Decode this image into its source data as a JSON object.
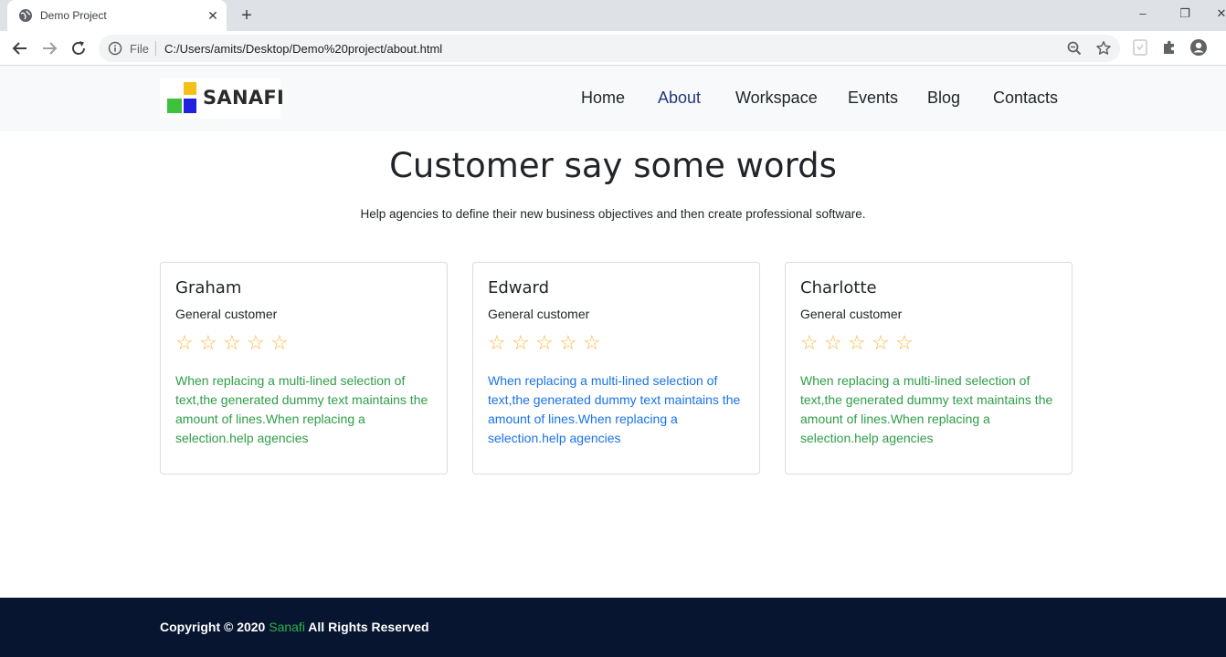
{
  "browser": {
    "tab_title": "Demo Project",
    "new_tab": "+",
    "close_tab": "✕",
    "window_controls": {
      "minimize": "–",
      "restore": "❐",
      "close": "✕"
    },
    "scheme_label": "File",
    "url": "C:/Users/amits/Desktop/Demo%20project/about.html"
  },
  "site": {
    "logo_text": "SANAFI",
    "nav": [
      {
        "label": "Home"
      },
      {
        "label": "About",
        "active": true
      },
      {
        "label": "Workspace"
      },
      {
        "label": "Events"
      },
      {
        "label": "Blog"
      },
      {
        "label": "Contacts"
      }
    ]
  },
  "hero": {
    "title": "Customer say some words",
    "subtitle": "Help agencies to define their new business objectives and then create professional software."
  },
  "testimonials": [
    {
      "name": "Graham",
      "role": "General customer",
      "rating": 0,
      "text": "When replacing a multi-lined selection of text,the generated dummy text maintains the amount of lines.When replacing a selection.help agencies",
      "text_color": "#2e9e47"
    },
    {
      "name": "Edward",
      "role": "General customer",
      "rating": 0,
      "text": "When replacing a multi-lined selection of text,the generated dummy text maintains the amount of lines.When replacing a selection.help agencies",
      "text_color": "#1a73e8"
    },
    {
      "name": "Charlotte",
      "role": "General customer",
      "rating": 0,
      "text": "When replacing a multi-lined selection of text,the generated dummy text maintains the amount of lines.When replacing a selection.help agencies",
      "text_color": "#2e9e47"
    }
  ],
  "star_glyph": "☆",
  "footer": {
    "prefix": "Copyright © 2020 ",
    "brand": "Sanafi",
    "suffix": " All Rights Reserved"
  },
  "colors": {
    "header_bg": "#f8f9fa",
    "footer_bg": "#071530",
    "active_nav": "#25397a",
    "brand_green": "#2fb34a",
    "star": "#f5b942"
  }
}
